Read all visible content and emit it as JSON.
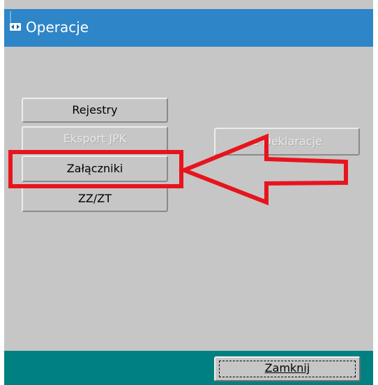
{
  "window": {
    "title": "Operacje"
  },
  "buttons": {
    "rejestry": "Rejestry",
    "eksport_jpk": "Eksport JPK",
    "zalaczniki": "Załączniki",
    "zzzt": "ZZ/ZT",
    "e_deklaracje": "e-Deklaracje",
    "zamknij": "Zamknij"
  },
  "colors": {
    "titlebar": "#2e85c8",
    "panel": "#c6c6c6",
    "footer": "#008080",
    "annotation": "#e8141c"
  },
  "icons": {
    "app": "app-window-icon",
    "annotation": "left-arrow-icon"
  }
}
